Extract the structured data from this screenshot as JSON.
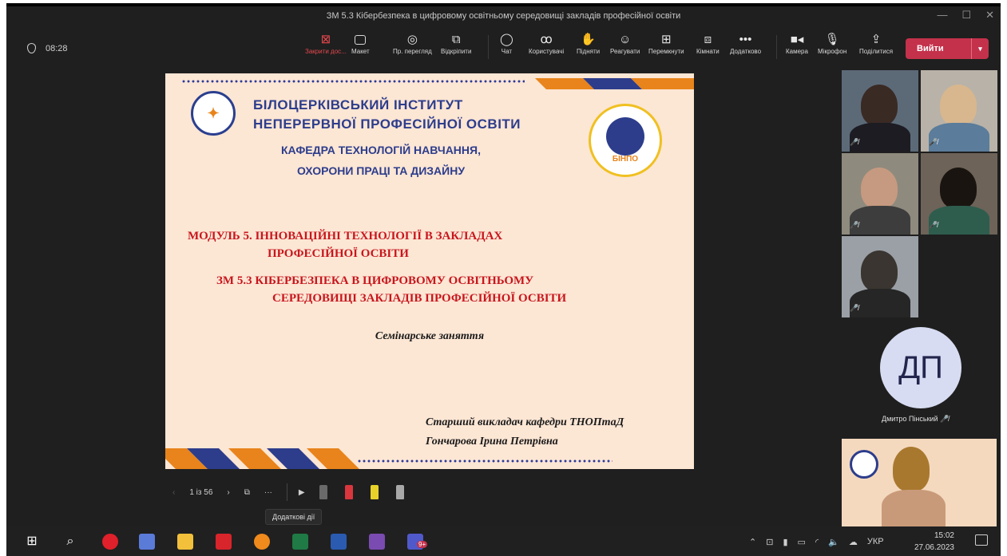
{
  "window": {
    "title": "ЗМ 5.3 Кібербезпека в цифровому освітньому середовищі закладів професійної освіти",
    "controls": [
      "—",
      "☐",
      "✕"
    ]
  },
  "meeting": {
    "elapsed": "08:28",
    "leave_label": "Вийти"
  },
  "toolbar": {
    "stop_share": "Закрити дос...",
    "layout": "Макет",
    "preview": "Пр. перегляд",
    "popout": "Відкріпити",
    "chat": "Чат",
    "people": "Користувачі",
    "raise": "Підняти",
    "react": "Реагувати",
    "rooms_switch": "Перемкнути",
    "rooms": "Кімнати",
    "more": "Додатково",
    "camera": "Камера",
    "mic": "Мікрофон",
    "share": "Поділитися"
  },
  "slide": {
    "institute_line1": "БІЛОЦЕРКІВСЬКИЙ ІНСТИТУТ",
    "institute_line2": "НЕПЕРЕРВНОЇ ПРОФЕСІЙНОЇ ОСВІТИ",
    "dept_line1": "КАФЕДРА ТЕХНОЛОГІЙ НАВЧАННЯ,",
    "dept_line2": "ОХОРОНИ ПРАЦІ ТА ДИЗАЙНУ",
    "logo_text": "БІНПО",
    "module_line1": "МОДУЛЬ 5. ІННОВАЦІЙНІ ТЕХНОЛОГІЇ В ЗАКЛАДАХ",
    "module_line2": "ПРОФЕСІЙНОЇ ОСВІТИ",
    "zm_line1": "ЗМ 5.3 КІБЕРБЕЗПЕКА В ЦИФРОВОМУ ОСВІТНЬОМУ",
    "zm_line2": "СЕРЕДОВИЩІ ЗАКЛАДІВ ПРОФЕСІЙНОЇ ОСВІТИ",
    "seminar": "Семінарське заняття",
    "author_line1": "Старший викладач кафедри ТНОПтаД",
    "author_line2": "Гончарова Ірина Петрівна"
  },
  "slide_nav": {
    "counter": "1 із 56",
    "tooltip": "Додаткові дії"
  },
  "participants": {
    "avatar_initials": "ДП",
    "avatar_name": "Дмитро Пінський"
  },
  "taskbar": {
    "lang": "УКР",
    "time": "15:02",
    "date": "27.06.2023",
    "teams_badge": "9+"
  },
  "colors": {
    "accent_blue": "#2d3d8c",
    "accent_orange": "#e8841b",
    "slide_bg": "#fce6d4",
    "leave_red": "#c4314b",
    "heading_red": "#c8161d"
  }
}
